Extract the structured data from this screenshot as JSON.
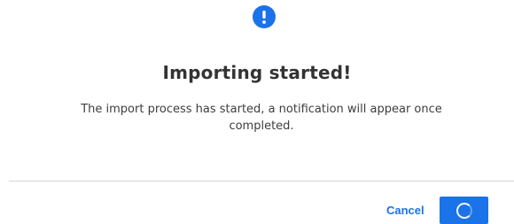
{
  "dialog": {
    "icon": "exclamation-circle-icon",
    "title": "Importing started!",
    "message": "The import process has started, a notification will appear once completed."
  },
  "actions": {
    "cancel_label": "Cancel",
    "confirm_state": "loading",
    "confirm_icon": "loading-spinner-icon"
  },
  "colors": {
    "accent": "#1a73e8",
    "title": "#333333",
    "text": "#3d3d3d",
    "divider": "#d6d6d6"
  }
}
